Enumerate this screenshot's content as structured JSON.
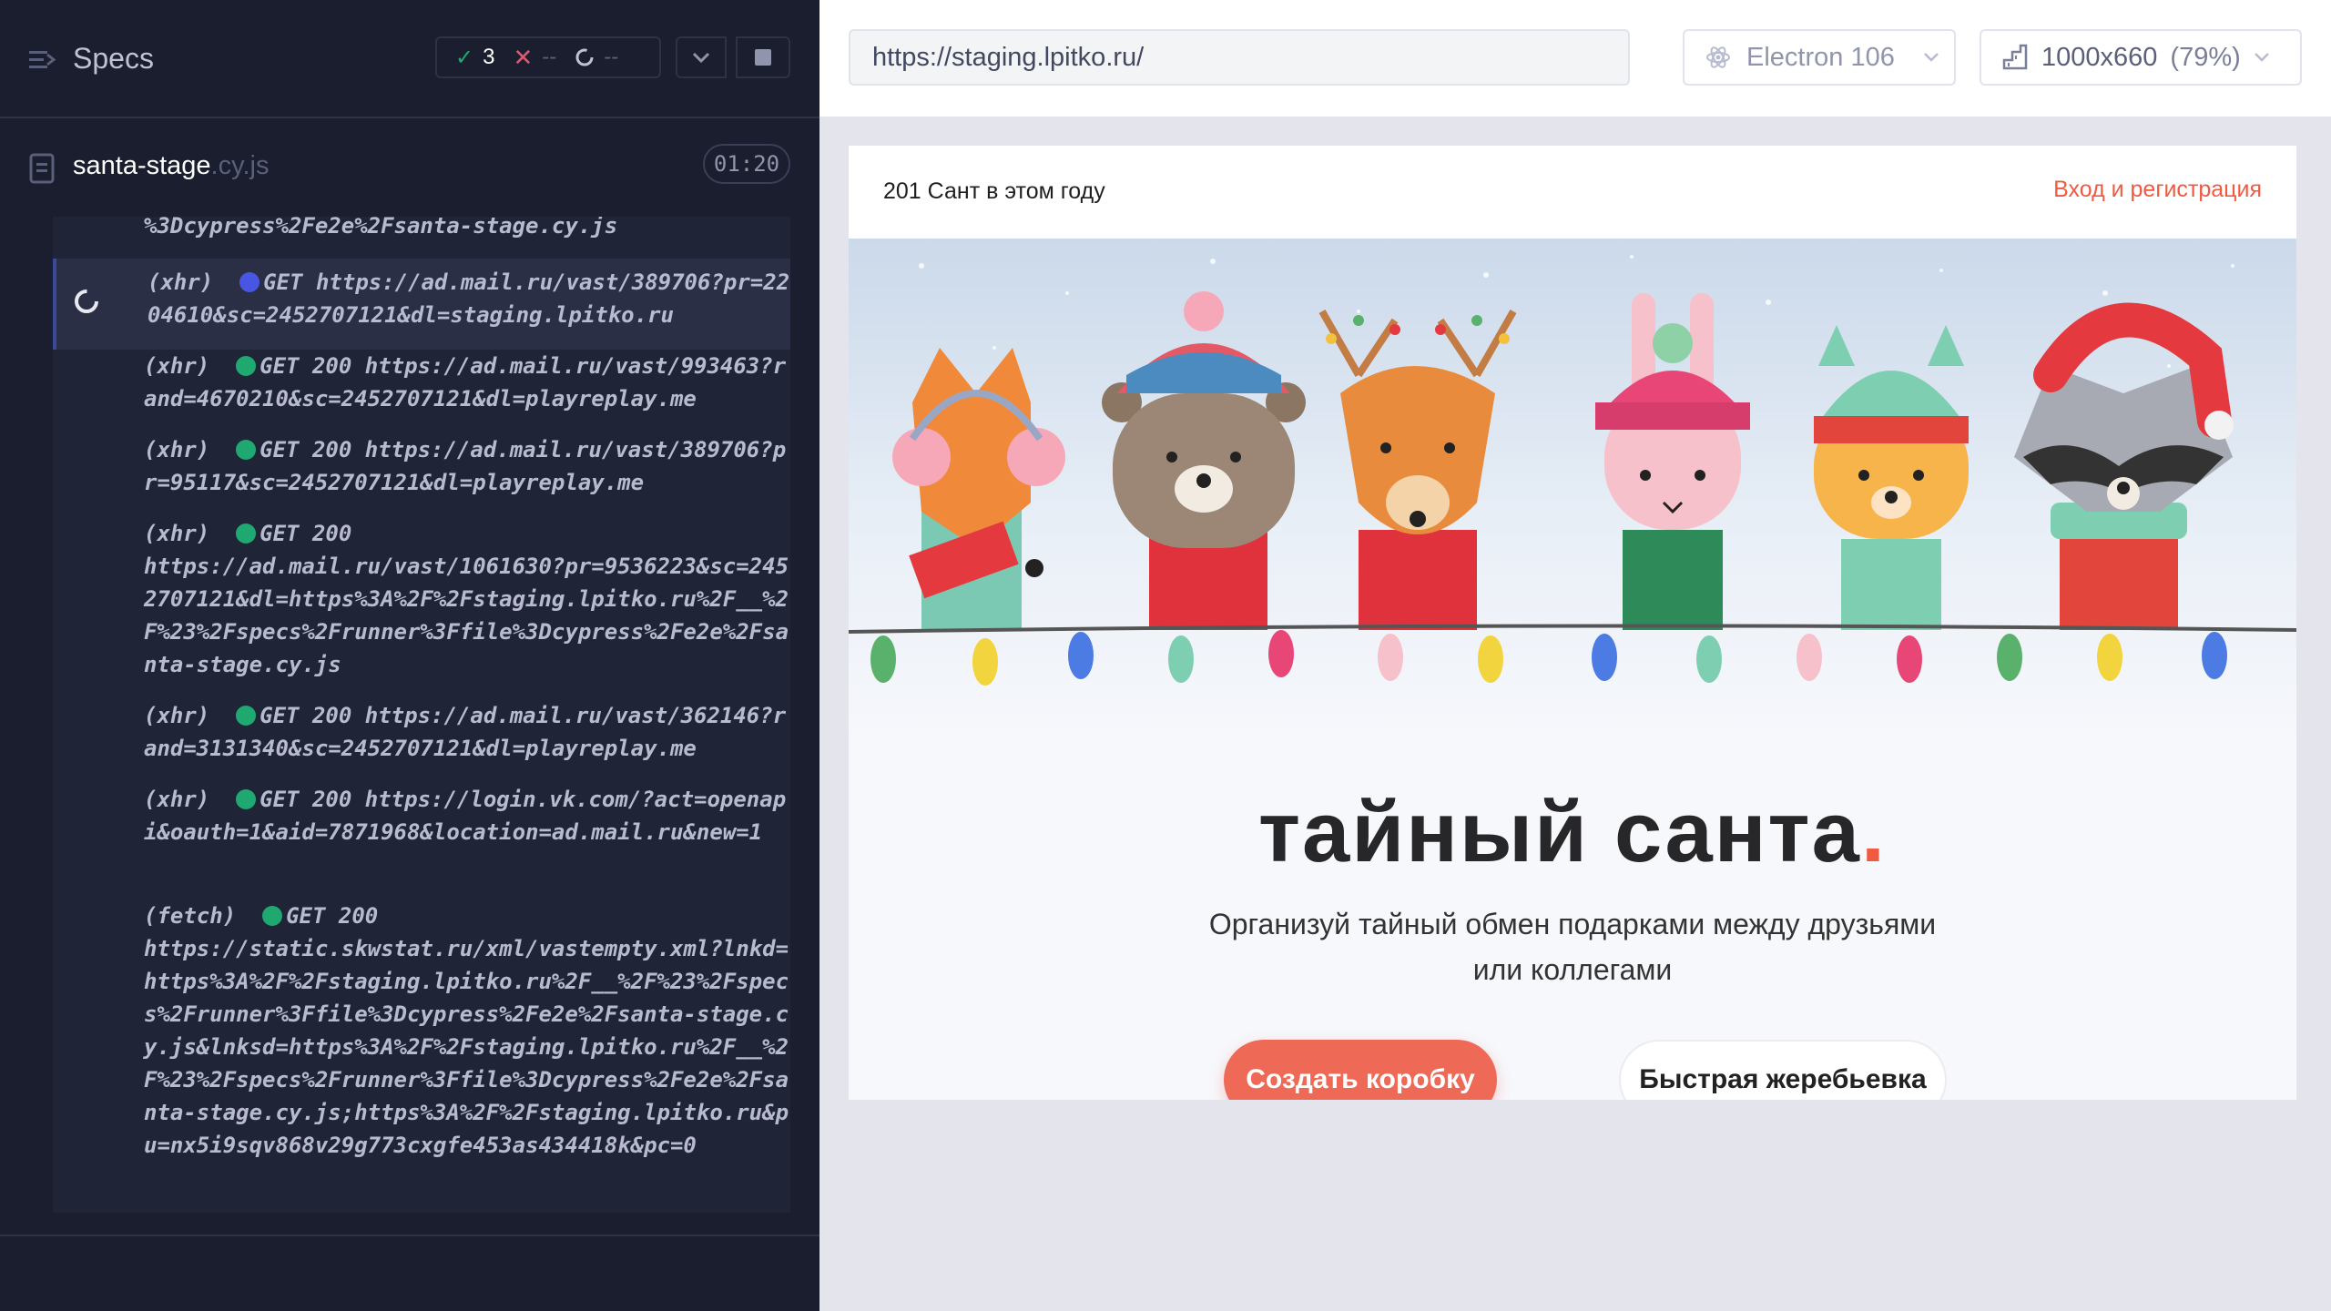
{
  "reporter": {
    "title": "Specs",
    "stats": {
      "passed": "3",
      "failed": "--",
      "pending": "--"
    },
    "spec_file": {
      "name": "santa-stage",
      "ext": ".cy.js",
      "duration": "01:20"
    },
    "log": [
      {
        "text": "%3Dcypress%2Fe2e%2Fsanta-stage.cy.js"
      },
      {
        "type": "(xhr)",
        "method": "GET",
        "status": "",
        "url": "https://ad.mail.ru/vast/389706?pr=2204610&sc=2452707121&dl=staging.lpitko.ru",
        "state": "pending"
      },
      {
        "type": "(xhr)",
        "method": "GET",
        "status": "200",
        "url": "https://ad.mail.ru/vast/993463?rand=4670210&sc=2452707121&dl=playreplay.me",
        "state": "done"
      },
      {
        "type": "(xhr)",
        "method": "GET",
        "status": "200",
        "url": "https://ad.mail.ru/vast/389706?pr=95117&sc=2452707121&dl=playreplay.me",
        "state": "done"
      },
      {
        "type": "(xhr)",
        "method": "GET",
        "status": "200",
        "url": "https://ad.mail.ru/vast/1061630?pr=9536223&sc=2452707121&dl=https%3A%2F%2Fstaging.lpitko.ru%2F__%2F%23%2Fspecs%2Frunner%3Ffile%3Dcypress%2Fe2e%2Fsanta-stage.cy.js",
        "state": "done"
      },
      {
        "type": "(xhr)",
        "method": "GET",
        "status": "200",
        "url": "https://ad.mail.ru/vast/362146?rand=3131340&sc=2452707121&dl=playreplay.me",
        "state": "done"
      },
      {
        "type": "(xhr)",
        "method": "GET",
        "status": "200",
        "url": "https://login.vk.com/?act=openapi&oauth=1&aid=7871968&location=ad.mail.ru&new=1",
        "state": "done"
      },
      {
        "type": "(fetch)",
        "method": "GET",
        "status": "200",
        "url": "https://static.skwstat.ru/xml/vastempty.xml?lnkd=https%3A%2F%2Fstaging.lpitko.ru%2F__%2F%23%2Fspecs%2Frunner%3Ffile%3Dcypress%2Fe2e%2Fsanta-stage.cy.js&lnksd=https%3A%2F%2Fstaging.lpitko.ru%2F__%2F%23%2Fspecs%2Frunner%3Ffile%3Dcypress%2Fe2e%2Fsanta-stage.cy.js;https%3A%2F%2Fstaging.lpitko.ru&pu=nx5i9sqv868v29g773cxgfe453as434418k&pc=0",
        "state": "done"
      }
    ]
  },
  "aut": {
    "url": "https://staging.lpitko.ru/",
    "browser": "Electron 106",
    "viewport": "1000x660",
    "scale": "(79%)"
  },
  "site": {
    "santa_count": "201 Сант в этом году",
    "login_link": "Вход и регистрация",
    "title": "тайный санта",
    "title_accent": ".",
    "subtitle": "Организуй тайный обмен подарками между друзьями или коллегами",
    "primary_button": "Создать коробку",
    "secondary_button": "Быстрая жеребьевка"
  },
  "colors": {
    "reporter_bg": "#1b1e2e",
    "log_bg": "#202437",
    "pass": "#1fa971",
    "fail": "#e45770",
    "xhr_pending": "#4956e3",
    "accent": "#ef5a41"
  }
}
